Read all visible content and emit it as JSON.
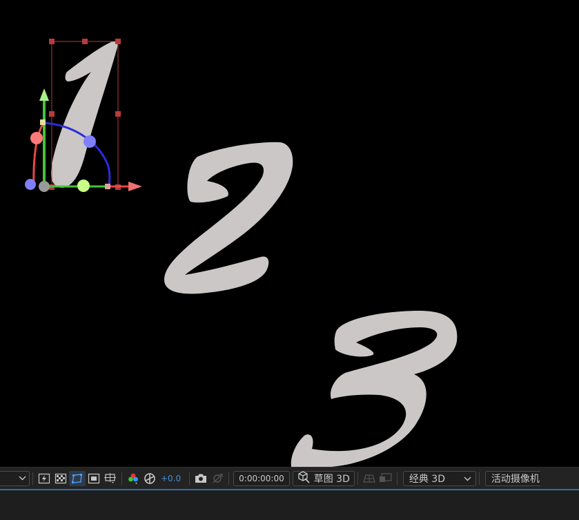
{
  "toolbar": {
    "exposure_value": "+0.0",
    "current_time": "0:00:00:00",
    "draft_3d_label": "草图 3D",
    "renderer_label": "经典 3D",
    "camera_label": "活动摄像机"
  },
  "colors": {
    "viewport_bg": "#000000",
    "digit_fill": "#ccc7c7",
    "bounding_box": "#b83a3a",
    "gizmo_red": "#e8484a",
    "gizmo_green": "#45c43a",
    "gizmo_blue": "#2b2bdc",
    "accent_blue": "#3d8fe0",
    "toolbar_bg": "#232323"
  },
  "icons": [
    "chevron-down-icon",
    "motion-blur-icon",
    "transparency-grid-icon",
    "mask-path-icon",
    "region-of-interest-icon",
    "guides-icon",
    "channel-rgb-icon",
    "exposure-reset-icon",
    "snapshot-camera-icon",
    "show-snapshot-icon",
    "draft-3d-cube-icon",
    "ground-plane-icon",
    "extended-viewer-icon"
  ]
}
